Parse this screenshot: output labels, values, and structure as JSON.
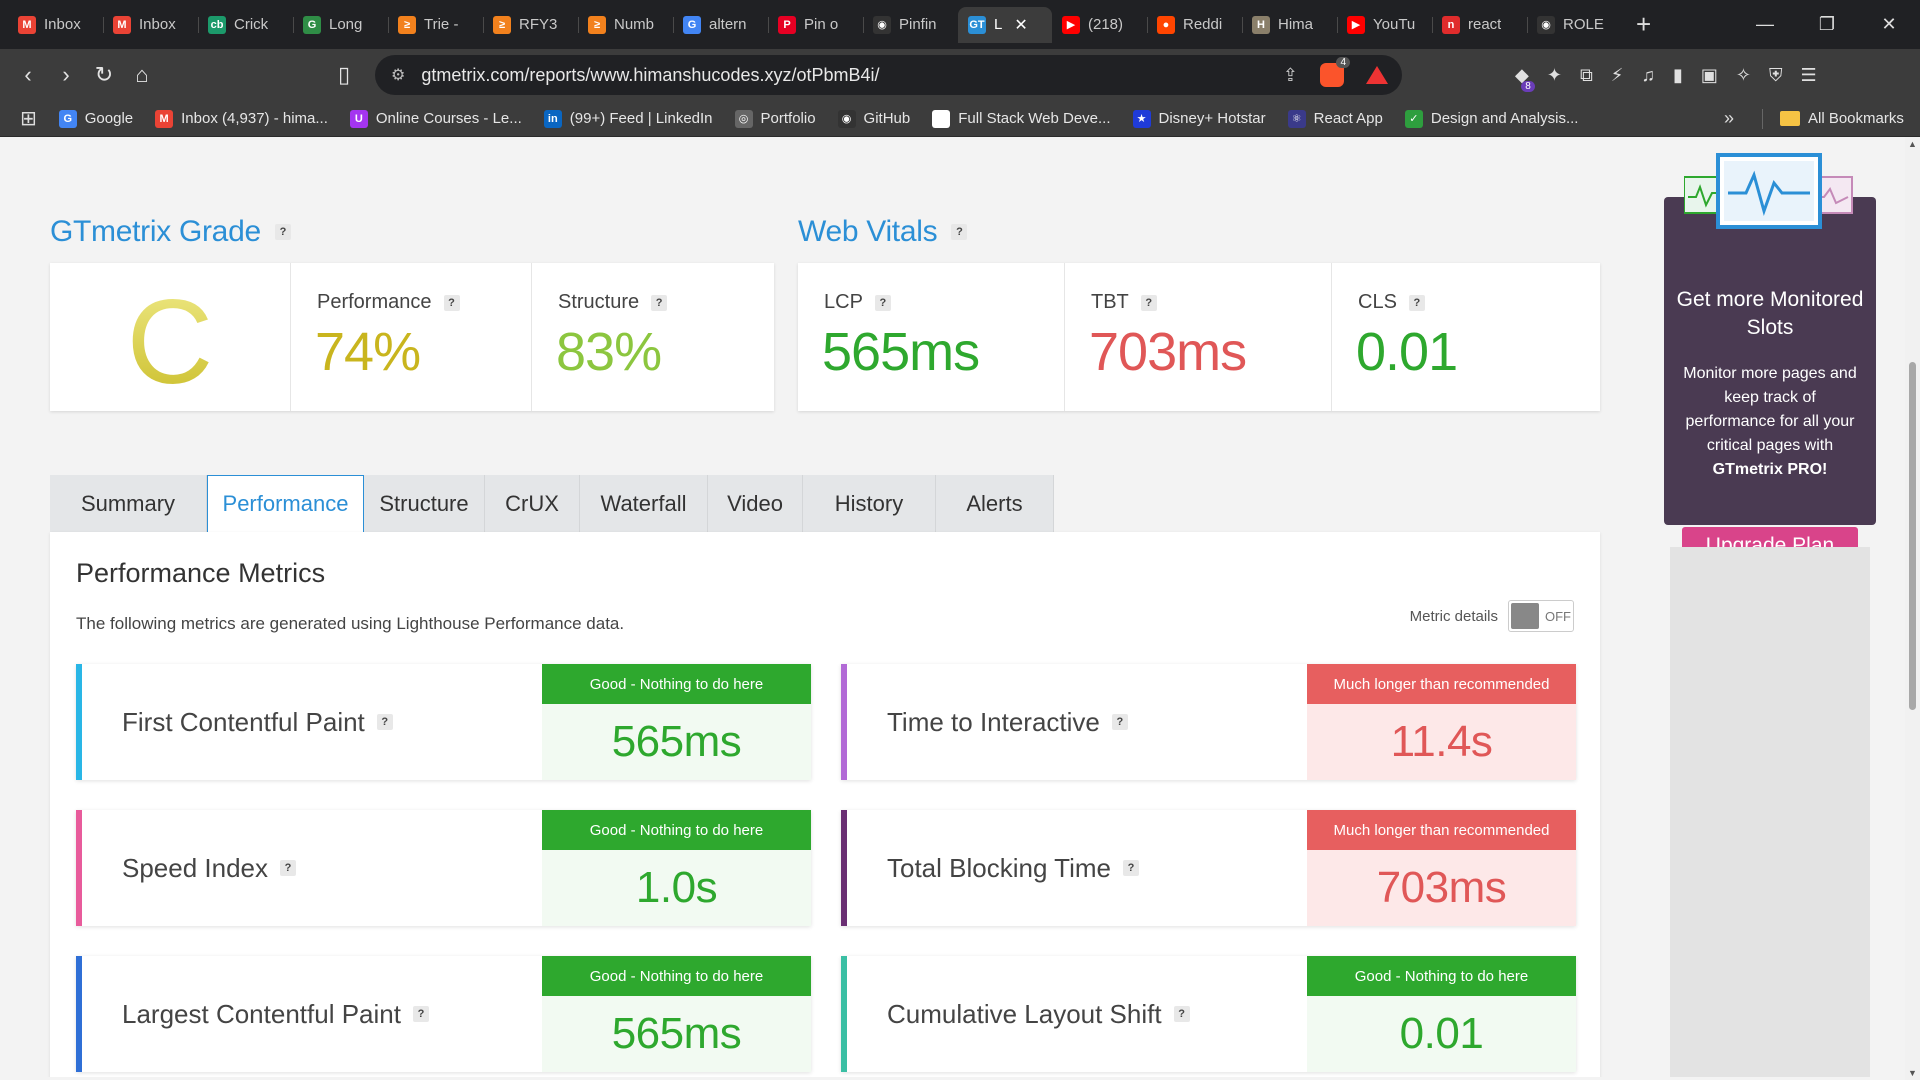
{
  "browser": {
    "tabs": [
      {
        "label": "Inbox",
        "icon": "gmail-icon",
        "color": "#ea4335",
        "glyph": "M"
      },
      {
        "label": "Inbox",
        "icon": "gmail-icon",
        "color": "#ea4335",
        "glyph": "M"
      },
      {
        "label": "Crick",
        "icon": "cricbuzz-icon",
        "color": "#1c9a6b",
        "glyph": "cb"
      },
      {
        "label": "Long",
        "icon": "gfg-icon",
        "color": "#2f8d46",
        "glyph": "G"
      },
      {
        "label": "Trie -",
        "icon": "codingninjas-icon",
        "color": "#f2811d",
        "glyph": "≥"
      },
      {
        "label": "RFY3",
        "icon": "codingninjas-icon",
        "color": "#f2811d",
        "glyph": "≥"
      },
      {
        "label": "Numb",
        "icon": "codingninjas-icon",
        "color": "#f2811d",
        "glyph": "≥"
      },
      {
        "label": "altern",
        "icon": "google-icon",
        "color": "#4285f4",
        "glyph": "G"
      },
      {
        "label": "Pin o",
        "icon": "pinterest-icon",
        "color": "#e60023",
        "glyph": "P"
      },
      {
        "label": "Pinfin",
        "icon": "github-icon",
        "color": "#333333",
        "glyph": "◉"
      },
      {
        "label": "L",
        "icon": "gtmetrix-icon",
        "color": "#2b8fd6",
        "glyph": "GT",
        "active": true
      },
      {
        "label": "(218)",
        "icon": "youtube-icon",
        "color": "#ff0000",
        "glyph": "▶"
      },
      {
        "label": "Reddi",
        "icon": "reddit-icon",
        "color": "#ff4500",
        "glyph": "●"
      },
      {
        "label": "Hima",
        "icon": "avatar-icon",
        "color": "#8a7f6a",
        "glyph": "H"
      },
      {
        "label": "YouTu",
        "icon": "youtube-icon",
        "color": "#ff0000",
        "glyph": "▶"
      },
      {
        "label": "react",
        "icon": "notion-icon",
        "color": "#e02c2c",
        "glyph": "n"
      },
      {
        "label": "ROLE",
        "icon": "github-icon",
        "color": "#333333",
        "glyph": "◉"
      }
    ],
    "url": "gtmetrix.com/reports/www.himanshucodes.xyz/otPbmB4i/",
    "brave_badge": "4",
    "ext_badge": "8",
    "bookmarks": [
      {
        "label": "Google",
        "color": "#4285f4",
        "glyph": "G"
      },
      {
        "label": "Inbox (4,937) - hima...",
        "color": "#ea4335",
        "glyph": "M"
      },
      {
        "label": "Online Courses - Le...",
        "color": "#a435f0",
        "glyph": "U"
      },
      {
        "label": "(99+) Feed | LinkedIn",
        "color": "#0a66c2",
        "glyph": "in"
      },
      {
        "label": "Portfolio",
        "color": "#666666",
        "glyph": "◎"
      },
      {
        "label": "GitHub",
        "color": "#333333",
        "glyph": "◉"
      },
      {
        "label": "Full Stack Web Deve...",
        "color": "#ffffff",
        "glyph": ""
      },
      {
        "label": "Disney+ Hotstar",
        "color": "#1f3bd8",
        "glyph": "★"
      },
      {
        "label": "React App",
        "color": "#3a3a8a",
        "glyph": "⚛"
      },
      {
        "label": "Design and Analysis...",
        "color": "#2e9e3e",
        "glyph": "✓"
      }
    ],
    "all_bookmarks": "All Bookmarks"
  },
  "grade": {
    "title": "GTmetrix Grade",
    "letter": "C",
    "performance_label": "Performance",
    "performance_value": "74%",
    "structure_label": "Structure",
    "structure_value": "83%"
  },
  "vitals": {
    "title": "Web Vitals",
    "lcp_label": "LCP",
    "lcp_value": "565ms",
    "tbt_label": "TBT",
    "tbt_value": "703ms",
    "cls_label": "CLS",
    "cls_value": "0.01"
  },
  "report_tabs": [
    "Summary",
    "Performance",
    "Structure",
    "CrUX",
    "Waterfall",
    "Video",
    "History",
    "Alerts"
  ],
  "active_tab": "Performance",
  "metrics_panel": {
    "title": "Performance Metrics",
    "description": "The following metrics are generated using Lighthouse Performance data.",
    "toggle_label": "Metric details",
    "toggle_state": "OFF",
    "metrics": [
      {
        "name": "First Contentful Paint",
        "status": "Good - Nothing to do here",
        "value": "565ms",
        "rating": "good",
        "bar": "#29b6e6"
      },
      {
        "name": "Time to Interactive",
        "status": "Much longer than recommended",
        "value": "11.4s",
        "rating": "bad",
        "bar": "#b26ad6"
      },
      {
        "name": "Speed Index",
        "status": "Good - Nothing to do here",
        "value": "1.0s",
        "rating": "good",
        "bar": "#e85b9b"
      },
      {
        "name": "Total Blocking Time",
        "status": "Much longer than recommended",
        "value": "703ms",
        "rating": "bad",
        "bar": "#6a2f73"
      },
      {
        "name": "Largest Contentful Paint",
        "status": "Good - Nothing to do here",
        "value": "565ms",
        "rating": "good",
        "bar": "#2f6fd6"
      },
      {
        "name": "Cumulative Layout Shift",
        "status": "Good - Nothing to do here",
        "value": "0.01",
        "rating": "good",
        "bar": "#3bbfa4"
      }
    ]
  },
  "promo": {
    "title": "Get more Monitored Slots",
    "text_before": "Monitor more pages and keep track of performance for all your critical pages with ",
    "text_bold": "GTmetrix PRO!",
    "button": "Upgrade Plan"
  },
  "colors": {
    "brand_blue": "#2b8fd6",
    "grade_c": "#d8cf3a",
    "perf_value": "#c9b51e",
    "structure_value": "#8cc63f",
    "good_green": "#2ea82e",
    "bad_red": "#e05757"
  }
}
